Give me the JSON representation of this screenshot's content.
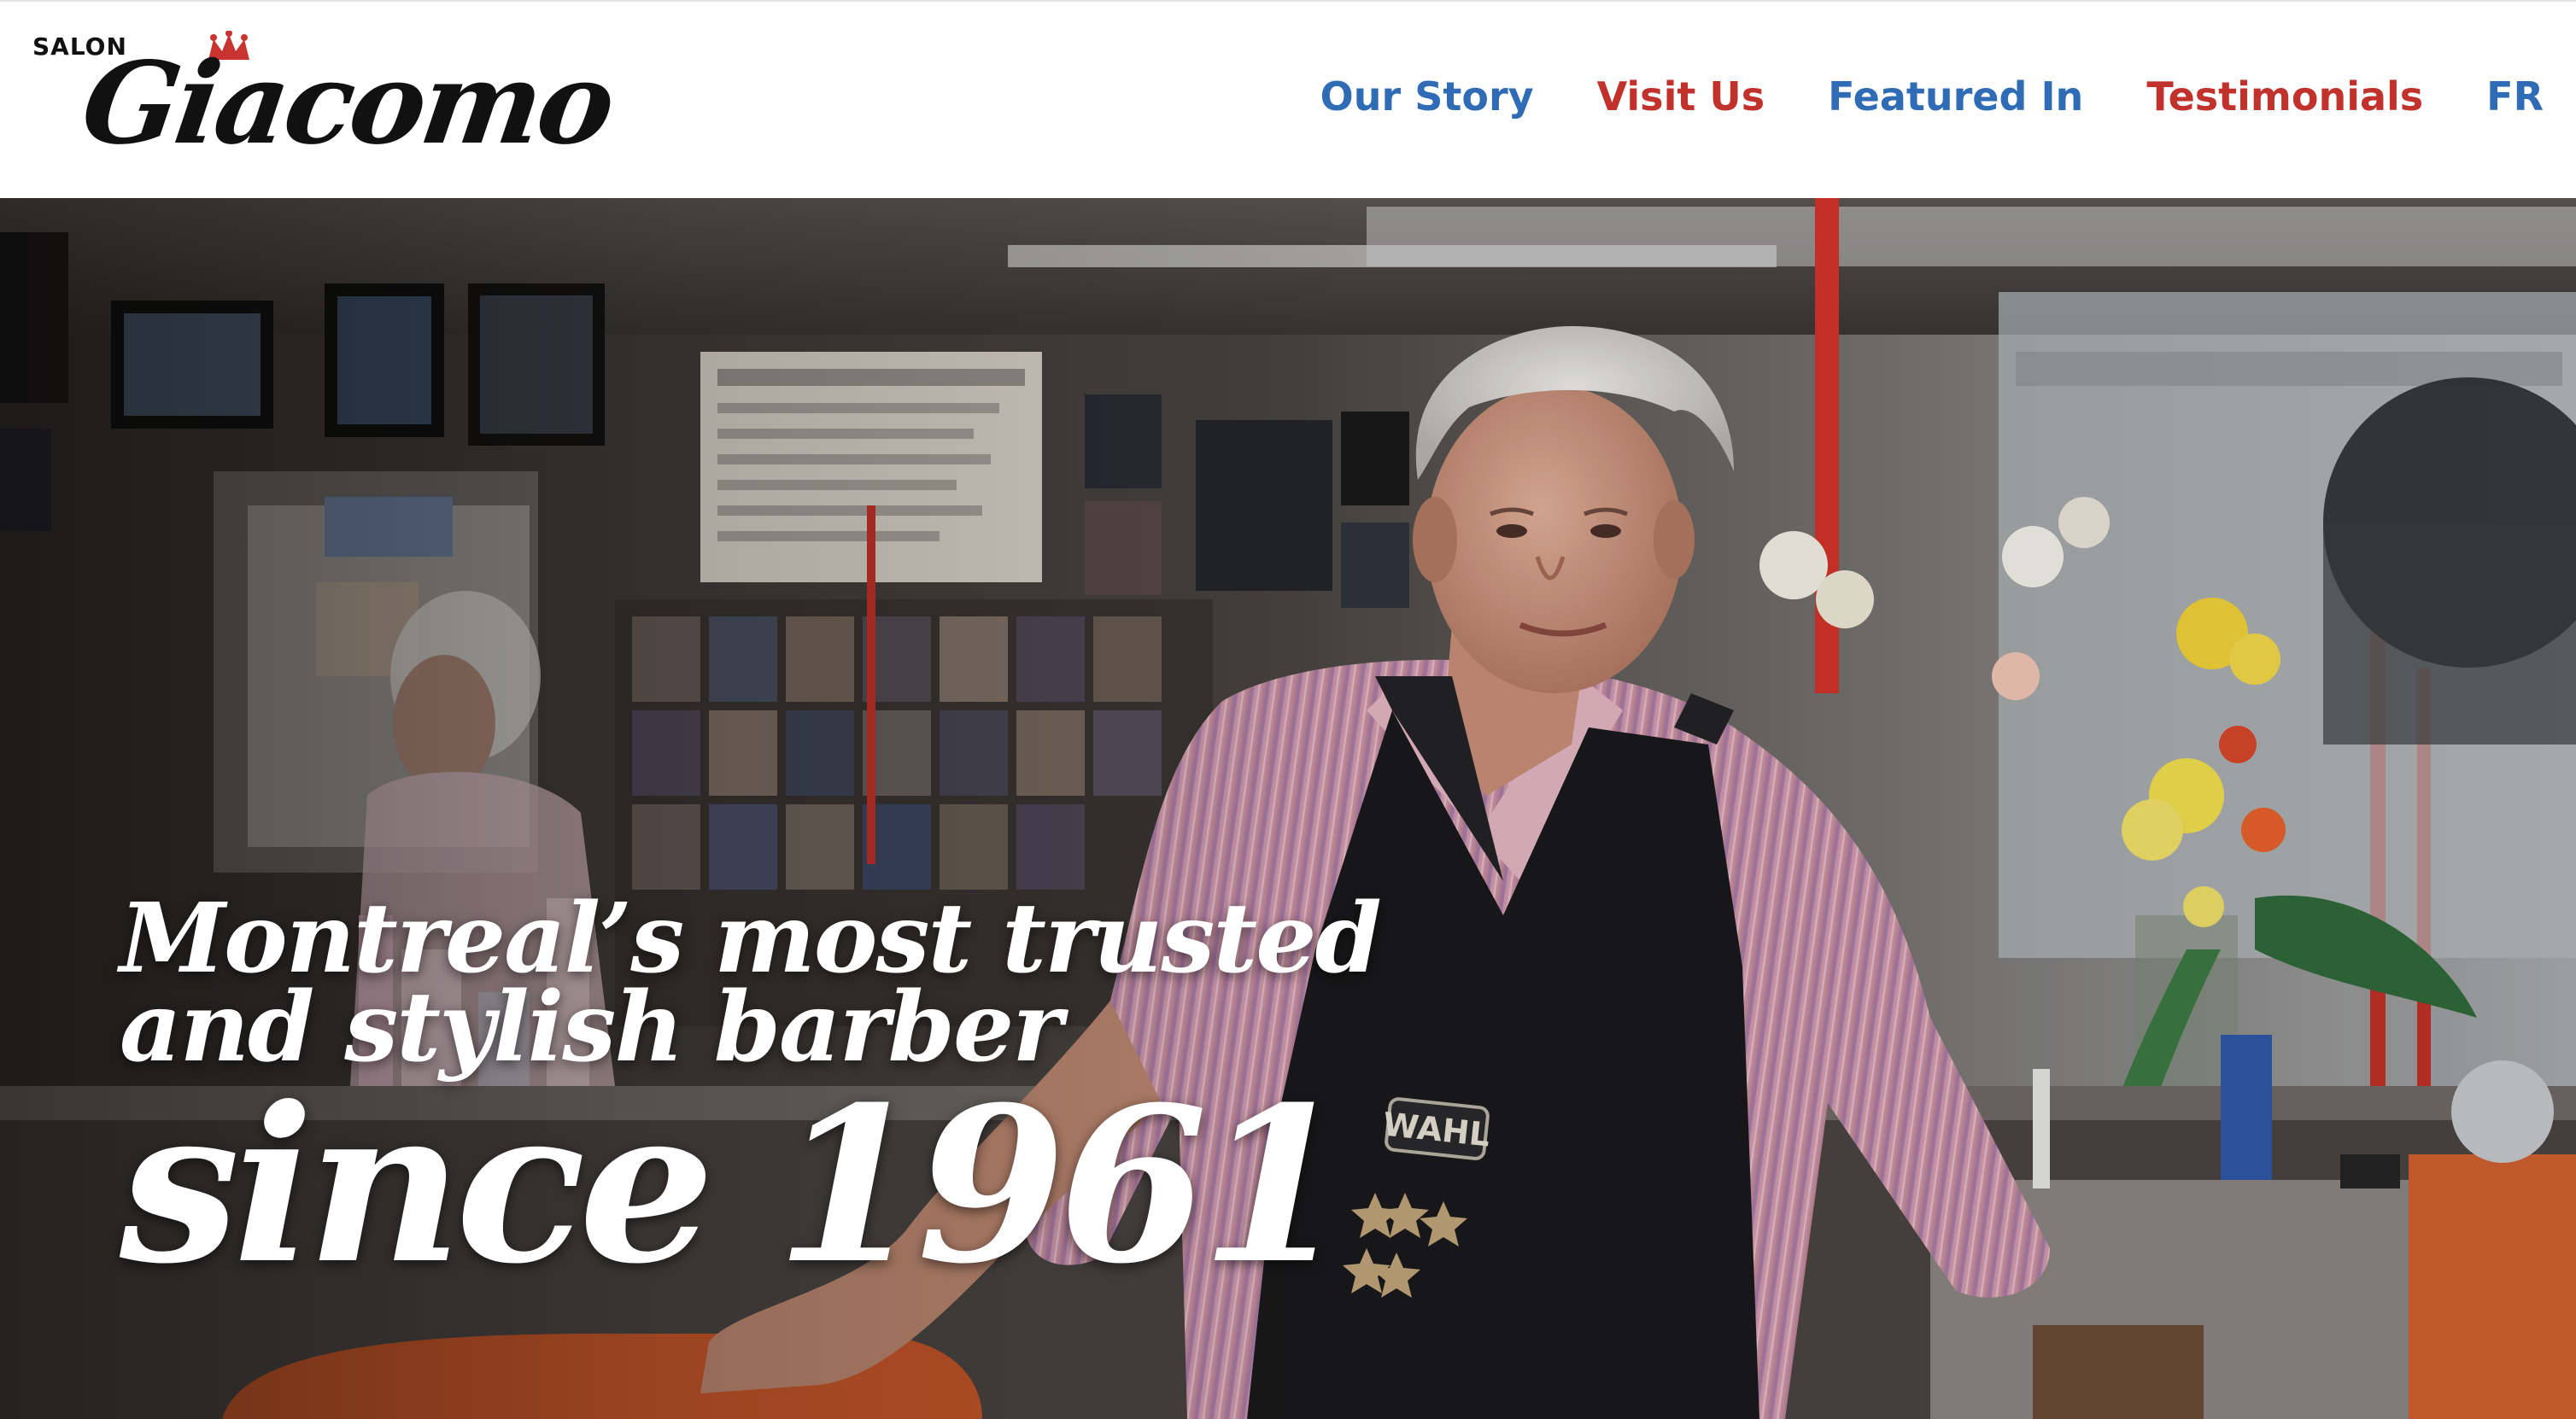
{
  "brand": {
    "prefix": "SALON",
    "name": "Giacomo",
    "crown_color": "#c8342f"
  },
  "nav": {
    "items": [
      {
        "label": "Our Story",
        "color": "#2f6cb5"
      },
      {
        "label": "Visit Us",
        "color": "#c1322c"
      },
      {
        "label": "Featured In",
        "color": "#2f6cb5"
      },
      {
        "label": "Testimonials",
        "color": "#c1322c"
      },
      {
        "label": "FR",
        "color": "#2f6cb5"
      }
    ]
  },
  "hero": {
    "headline_line1": "Montreal’s most trusted",
    "headline_line2": "and stylish barber",
    "headline_line3": "since 1961",
    "apron_text": "WAHL",
    "image_description_icon": "barber-portrait-photo"
  }
}
